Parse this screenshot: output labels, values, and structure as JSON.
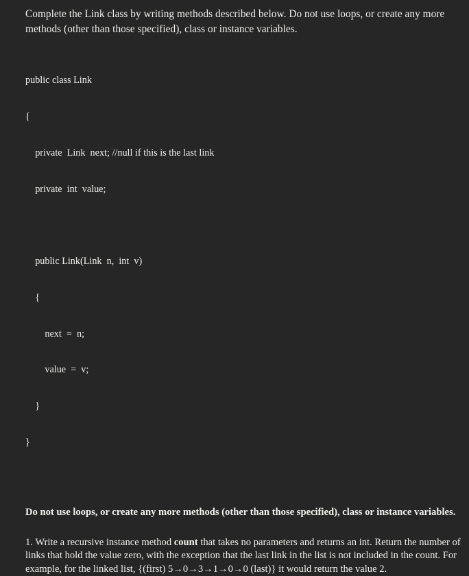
{
  "colors": {
    "background": "#262626",
    "text": "#f2f0ed"
  },
  "intro": {
    "text": "Complete the Link class by writing methods described below. Do not use loops, or create any more methods (other than those specified), class or instance variables."
  },
  "code": {
    "language": "java",
    "lines": [
      "public class Link",
      "{",
      "    private  Link  next; //null if this is the last link",
      "    private  int  value;",
      "",
      "    public Link(Link  n,  int  v)",
      "    {",
      "        next  =  n;",
      "        value  =  v;",
      "    }",
      "}"
    ]
  },
  "bold_note": {
    "text": "Do not use loops, or create any more methods (other than those specified), class or instance variables."
  },
  "task": {
    "number": "1.",
    "part1": "Write a recursive instance method",
    "method_name": "count",
    "part2": "that takes no parameters and returns an int. Return the number of links that hold the value zero, with the exception that the last link in the list is not included in the count. For example, for the linked list,",
    "linked_list": "{(first) 5→0→3→1→0→0 (last)}",
    "part3": "it would return the value 2."
  }
}
